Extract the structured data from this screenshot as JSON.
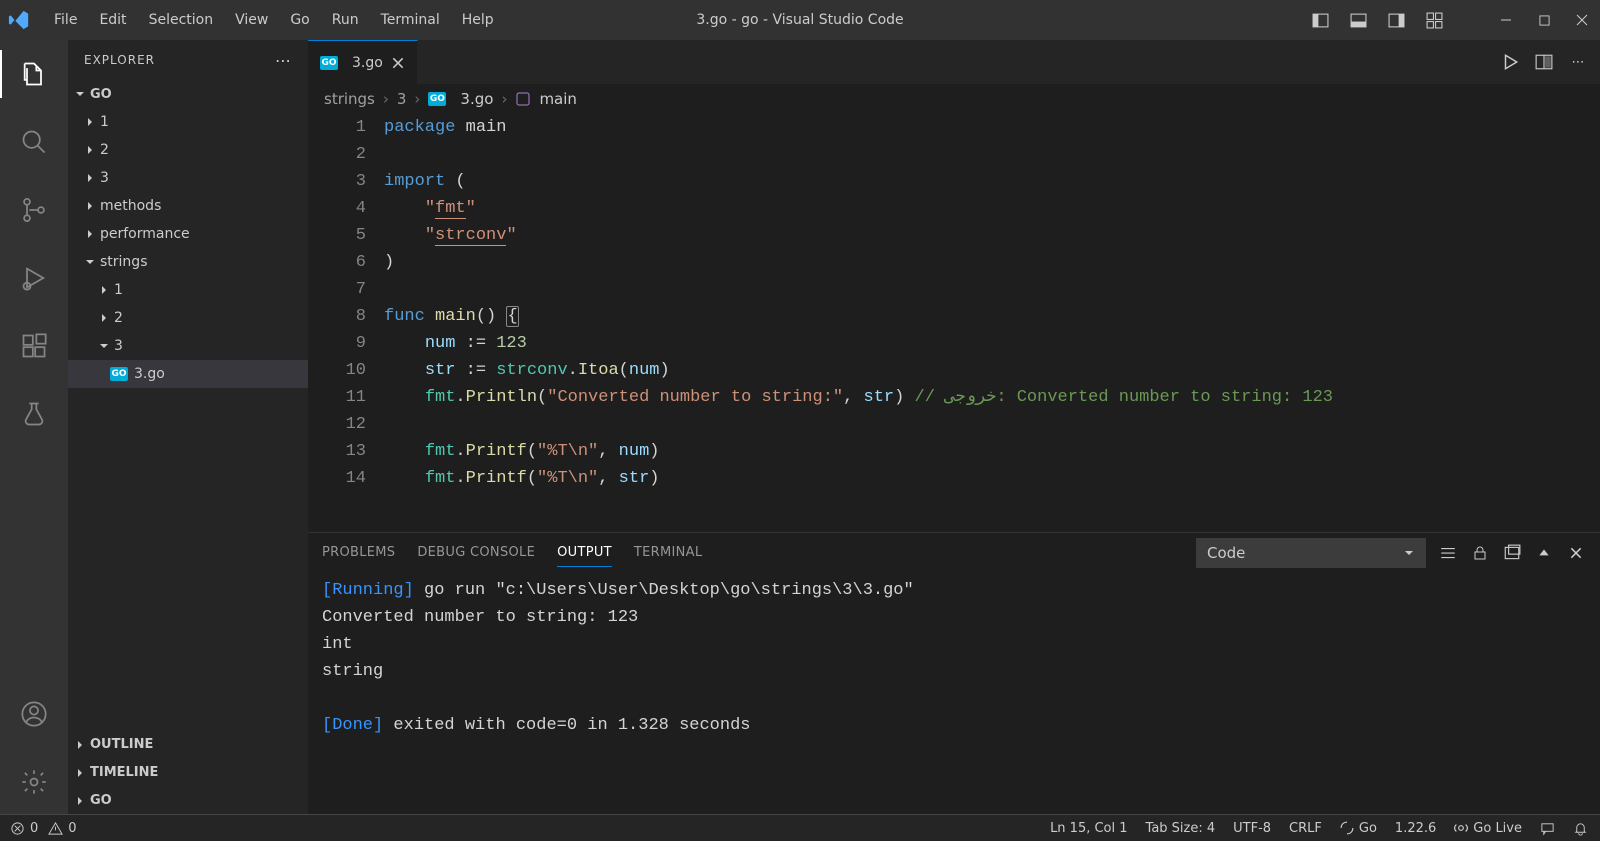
{
  "menu": [
    "File",
    "Edit",
    "Selection",
    "View",
    "Go",
    "Run",
    "Terminal",
    "Help"
  ],
  "windowTitle": "3.go - go - Visual Studio Code",
  "explorer": {
    "title": "EXPLORER",
    "root": "GO",
    "tree": [
      {
        "label": "1",
        "depth": 0,
        "folder": true,
        "open": false
      },
      {
        "label": "2",
        "depth": 0,
        "folder": true,
        "open": false
      },
      {
        "label": "3",
        "depth": 0,
        "folder": true,
        "open": false
      },
      {
        "label": "methods",
        "depth": 0,
        "folder": true,
        "open": false
      },
      {
        "label": "performance",
        "depth": 0,
        "folder": true,
        "open": false
      },
      {
        "label": "strings",
        "depth": 0,
        "folder": true,
        "open": true
      },
      {
        "label": "1",
        "depth": 1,
        "folder": true,
        "open": false
      },
      {
        "label": "2",
        "depth": 1,
        "folder": true,
        "open": false
      },
      {
        "label": "3",
        "depth": 1,
        "folder": true,
        "open": true
      },
      {
        "label": "3.go",
        "depth": 2,
        "folder": false,
        "active": true
      }
    ],
    "sections": [
      "OUTLINE",
      "TIMELINE",
      "GO"
    ]
  },
  "tab": {
    "label": "3.go"
  },
  "breadcrumb": [
    "strings",
    "3",
    "3.go",
    "main"
  ],
  "code": {
    "lines": [
      [
        {
          "t": "package ",
          "c": "keyword"
        },
        {
          "t": "main",
          "c": "default"
        }
      ],
      [],
      [
        {
          "t": "import ",
          "c": "keyword"
        },
        {
          "t": "(",
          "c": "default"
        }
      ],
      [
        {
          "t": "    ",
          "c": "default"
        },
        {
          "t": "\"",
          "c": "string"
        },
        {
          "t": "fmt",
          "c": "string underline"
        },
        {
          "t": "\"",
          "c": "string"
        }
      ],
      [
        {
          "t": "    ",
          "c": "default"
        },
        {
          "t": "\"",
          "c": "string"
        },
        {
          "t": "strconv",
          "c": "string underline"
        },
        {
          "t": "\"",
          "c": "string"
        }
      ],
      [
        {
          "t": ")",
          "c": "default"
        }
      ],
      [],
      [
        {
          "t": "func ",
          "c": "keyword"
        },
        {
          "t": "main",
          "c": "func"
        },
        {
          "t": "() ",
          "c": "default"
        },
        {
          "t": "{",
          "c": "default brace"
        }
      ],
      [
        {
          "t": "    ",
          "c": "default"
        },
        {
          "t": "num",
          "c": "var"
        },
        {
          "t": " := ",
          "c": "default"
        },
        {
          "t": "123",
          "c": "num"
        }
      ],
      [
        {
          "t": "    ",
          "c": "default"
        },
        {
          "t": "str",
          "c": "var"
        },
        {
          "t": " := ",
          "c": "default"
        },
        {
          "t": "strconv",
          "c": "type"
        },
        {
          "t": ".",
          "c": "default"
        },
        {
          "t": "Itoa",
          "c": "func"
        },
        {
          "t": "(",
          "c": "default"
        },
        {
          "t": "num",
          "c": "var"
        },
        {
          "t": ")",
          "c": "default"
        }
      ],
      [
        {
          "t": "    ",
          "c": "default"
        },
        {
          "t": "fmt",
          "c": "type"
        },
        {
          "t": ".",
          "c": "default"
        },
        {
          "t": "Println",
          "c": "func"
        },
        {
          "t": "(",
          "c": "default"
        },
        {
          "t": "\"Converted number to string:\"",
          "c": "string"
        },
        {
          "t": ", ",
          "c": "default"
        },
        {
          "t": "str",
          "c": "var"
        },
        {
          "t": ") ",
          "c": "default"
        },
        {
          "t": "// خروجی: Converted number to string: 123",
          "c": "comment"
        }
      ],
      [],
      [
        {
          "t": "    ",
          "c": "default"
        },
        {
          "t": "fmt",
          "c": "type"
        },
        {
          "t": ".",
          "c": "default"
        },
        {
          "t": "Printf",
          "c": "func"
        },
        {
          "t": "(",
          "c": "default"
        },
        {
          "t": "\"%T\\n\"",
          "c": "string"
        },
        {
          "t": ", ",
          "c": "default"
        },
        {
          "t": "num",
          "c": "var"
        },
        {
          "t": ")",
          "c": "default"
        }
      ],
      [
        {
          "t": "    ",
          "c": "default"
        },
        {
          "t": "fmt",
          "c": "type"
        },
        {
          "t": ".",
          "c": "default"
        },
        {
          "t": "Printf",
          "c": "func"
        },
        {
          "t": "(",
          "c": "default"
        },
        {
          "t": "\"%T\\n\"",
          "c": "string"
        },
        {
          "t": ", ",
          "c": "default"
        },
        {
          "t": "str",
          "c": "var"
        },
        {
          "t": ")",
          "c": "default"
        }
      ]
    ]
  },
  "panel": {
    "tabs": [
      "PROBLEMS",
      "DEBUG CONSOLE",
      "OUTPUT",
      "TERMINAL"
    ],
    "activeTab": 2,
    "select": "Code",
    "outputLines": [
      [
        {
          "t": "[Running] ",
          "c": "blue"
        },
        {
          "t": "go run \"c:\\Users\\User\\Desktop\\go\\strings\\3\\3.go\"",
          "c": "text"
        }
      ],
      [
        {
          "t": "Converted number to string: 123",
          "c": "text"
        }
      ],
      [
        {
          "t": "int",
          "c": "text"
        }
      ],
      [
        {
          "t": "string",
          "c": "text"
        }
      ],
      [],
      [
        {
          "t": "[Done] ",
          "c": "blue"
        },
        {
          "t": "exited with code=0 in 1.328 seconds",
          "c": "text"
        }
      ]
    ]
  },
  "status": {
    "errors": "0",
    "warnings": "0",
    "lnCol": "Ln 15, Col 1",
    "tabSize": "Tab Size: 4",
    "encoding": "UTF-8",
    "eol": "CRLF",
    "lang": "Go",
    "version": "1.22.6",
    "goLive": "Go Live"
  }
}
